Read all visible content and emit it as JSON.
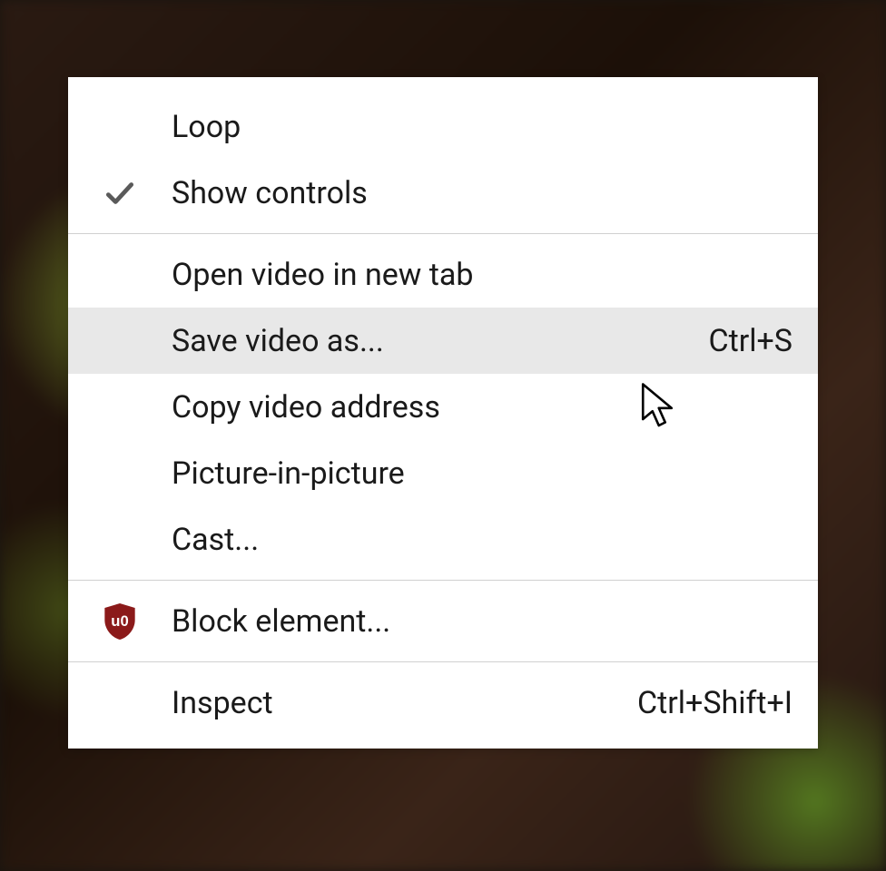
{
  "menu": {
    "items": {
      "loop": {
        "label": "Loop",
        "checked": false
      },
      "show_controls": {
        "label": "Show controls",
        "checked": true
      },
      "open_new_tab": {
        "label": "Open video in new tab"
      },
      "save_as": {
        "label": "Save video as...",
        "shortcut": "Ctrl+S",
        "hovered": true
      },
      "copy_address": {
        "label": "Copy video address"
      },
      "pip": {
        "label": "Picture-in-picture"
      },
      "cast": {
        "label": "Cast..."
      },
      "block_element": {
        "label": "Block element...",
        "icon": "ublock-shield"
      },
      "inspect": {
        "label": "Inspect",
        "shortcut": "Ctrl+Shift+I"
      }
    }
  }
}
